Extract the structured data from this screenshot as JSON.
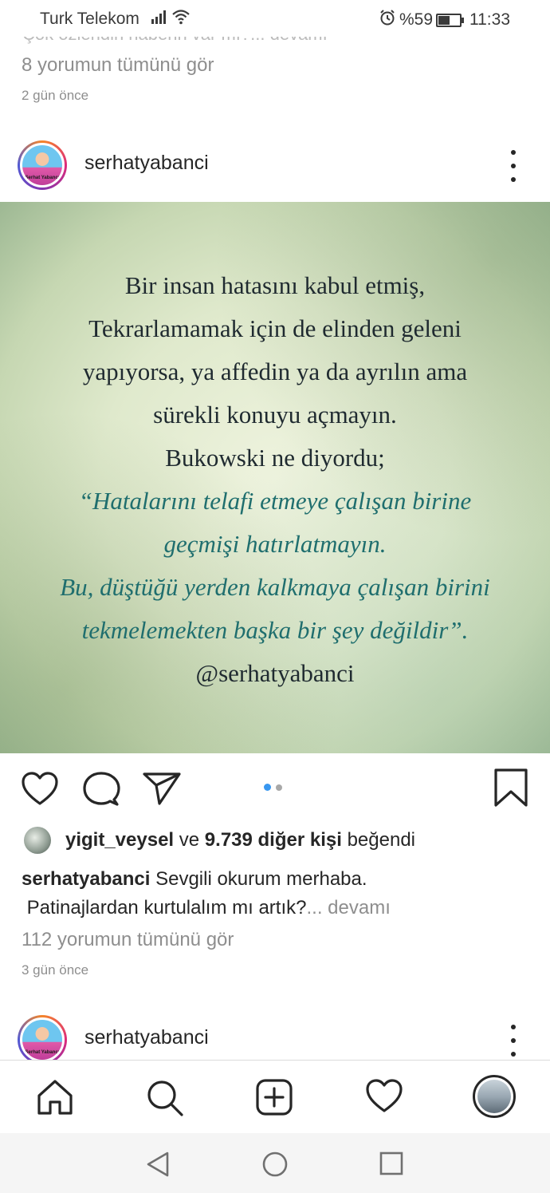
{
  "status_bar": {
    "carrier": "Turk Telekom",
    "battery": "%59",
    "time": "11:33",
    "battery_level": 0.59
  },
  "previous_post": {
    "cut_caption": "Çok özlendin haberin var mı?... devamı",
    "view_comments": "8 yorumun tümünü gör",
    "time_ago": "2 gün önce"
  },
  "post": {
    "username": "serhatyabanci",
    "avatar_caption": "Serhat Yabancı",
    "quote_plain": [
      "Bir insan hatasını kabul etmiş,",
      "Tekrarlamamak için de elinden geleni",
      "yapıyorsa, ya affedin ya da ayrılın ama",
      "sürekli konuyu açmayın.",
      "Bukowski ne diyordu;"
    ],
    "quote_italic": [
      "“Hatalarını telafi etmeye çalışan birine",
      "geçmişi hatırlatmayın.",
      "Bu, düştüğü yerden kalkmaya çalışan birini",
      "tekmelemekten başka bir şey değildir”."
    ],
    "quote_signature": "@serhatyabanci",
    "carousel": {
      "count": 2,
      "active": 0
    },
    "likes": {
      "first_user": "yigit_veysel",
      "connector": "ve",
      "others": "9.739 diğer kişi",
      "suffix": "beğendi"
    },
    "caption": {
      "username": "serhatyabanci",
      "line1": "Sevgili okurum merhaba.",
      "line2": "Patinajlardan kurtulalım mı artık?",
      "more": "... devamı"
    },
    "view_comments": "112 yorumun tümünü gör",
    "time_ago": "3 gün önce"
  },
  "next_post": {
    "username": "serhatyabanci",
    "avatar_caption": "Serhat Yabancı"
  },
  "icons": {
    "signal": "signal-icon",
    "wifi": "wifi-icon",
    "alarm": "alarm-icon",
    "battery": "battery-icon",
    "like": "heart-icon",
    "comment": "comment-icon",
    "share": "send-icon",
    "save": "bookmark-icon",
    "home": "home-icon",
    "search": "search-icon",
    "add": "add-post-icon",
    "activity": "heart-icon",
    "back": "back-triangle-icon",
    "home_sys": "home-circle-icon",
    "recents": "recents-square-icon"
  },
  "colors": {
    "text": "#262626",
    "muted": "#8e8e8e",
    "carousel_active": "#3897f0",
    "carousel_inactive": "#a8a8a8",
    "quote_dark": "#1f2a30",
    "quote_teal": "#1f6e6e"
  }
}
